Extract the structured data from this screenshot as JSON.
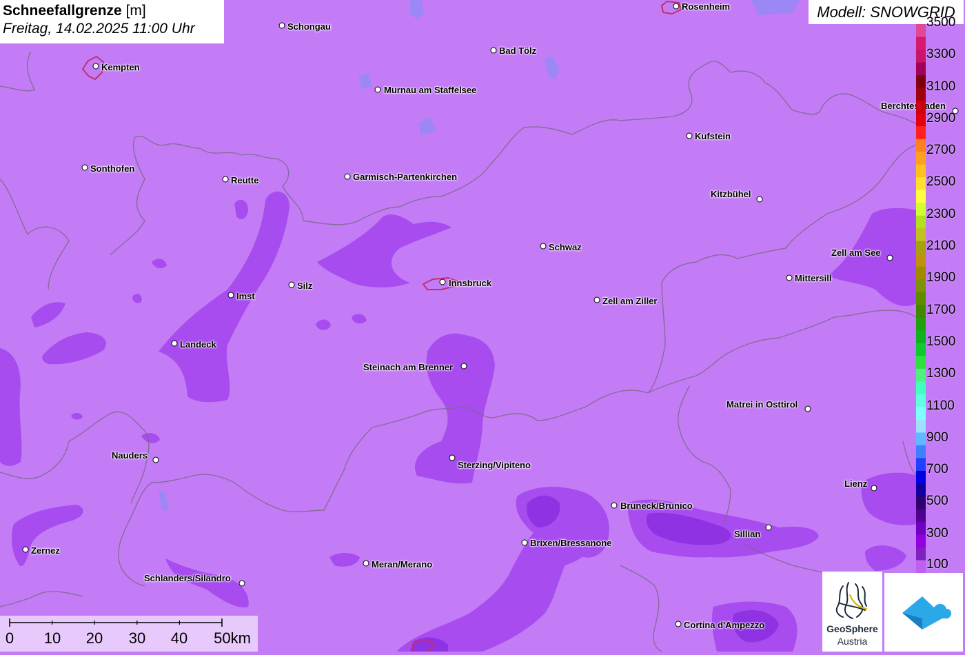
{
  "title": {
    "main": "Schneefallgrenze",
    "unit": "[m]",
    "datetime": "Freitag, 14.02.2025 11:00 Uhr"
  },
  "model": "Modell: SNOWGRID",
  "legend": {
    "labels": [
      "3500",
      "3300",
      "3100",
      "2900",
      "2700",
      "2500",
      "2300",
      "2100",
      "1900",
      "1700",
      "1500",
      "1300",
      "1100",
      "900",
      "700",
      "500",
      "300",
      "100"
    ],
    "colors": [
      "#e0489a",
      "#d81a6f",
      "#c8146a",
      "#a0005a",
      "#7d0010",
      "#a00010",
      "#c80010",
      "#e00010",
      "#ff2020",
      "#ff8020",
      "#ffa020",
      "#ffc020",
      "#ffe030",
      "#ffff40",
      "#d0ff30",
      "#b0e020",
      "#c0c020",
      "#a8a010",
      "#c09010",
      "#a08a00",
      "#80900a",
      "#608a00",
      "#408800",
      "#20a010",
      "#10b020",
      "#10c830",
      "#30e040",
      "#50f080",
      "#40ffc0",
      "#60ffe0",
      "#80ffff",
      "#a0e0ff",
      "#60b8ff",
      "#4080ff",
      "#2040ff",
      "#0000e0",
      "#1000a0",
      "#300070",
      "#500090",
      "#7000c0",
      "#9000e0",
      "#8020c0",
      "#c060f0"
    ]
  },
  "cities": [
    {
      "name": "Rosenheim"
    },
    {
      "name": "Schongau"
    },
    {
      "name": "Bad Tölz"
    },
    {
      "name": "Kempten"
    },
    {
      "name": "Murnau am Staffelsee"
    },
    {
      "name": "Berchtesgaden"
    },
    {
      "name": "Kufstein"
    },
    {
      "name": "Sonthofen"
    },
    {
      "name": "Reutte"
    },
    {
      "name": "Garmisch-Partenkirchen"
    },
    {
      "name": "Kitzbühel"
    },
    {
      "name": "Schwaz"
    },
    {
      "name": "Zell am See"
    },
    {
      "name": "Mittersill"
    },
    {
      "name": "Innsbruck"
    },
    {
      "name": "Silz"
    },
    {
      "name": "Imst"
    },
    {
      "name": "Zell am Ziller"
    },
    {
      "name": "Landeck"
    },
    {
      "name": "Steinach am Brenner"
    },
    {
      "name": "Matrei in Osttirol"
    },
    {
      "name": "Nauders"
    },
    {
      "name": "Sterzing/Vipiteno"
    },
    {
      "name": "Lienz"
    },
    {
      "name": "Bruneck/Brunico"
    },
    {
      "name": "Sillian"
    },
    {
      "name": "Brixen/Bressanone"
    },
    {
      "name": "Zernez"
    },
    {
      "name": "Meran/Merano"
    },
    {
      "name": "Schlanders/Silandro"
    },
    {
      "name": "Cortina d'Ampezzo"
    }
  ],
  "scale": {
    "labels": [
      "0",
      "10",
      "20",
      "30",
      "40",
      "50km"
    ]
  },
  "logos": {
    "geosphere_line1": "GeoSphere",
    "geosphere_line2": "Austria"
  },
  "colors": {
    "base_fill": "#c47cf6",
    "darker_fill": "#9a3ee6",
    "darkest_fill": "#7a1ed8",
    "border_line": "#7a6a8a"
  }
}
